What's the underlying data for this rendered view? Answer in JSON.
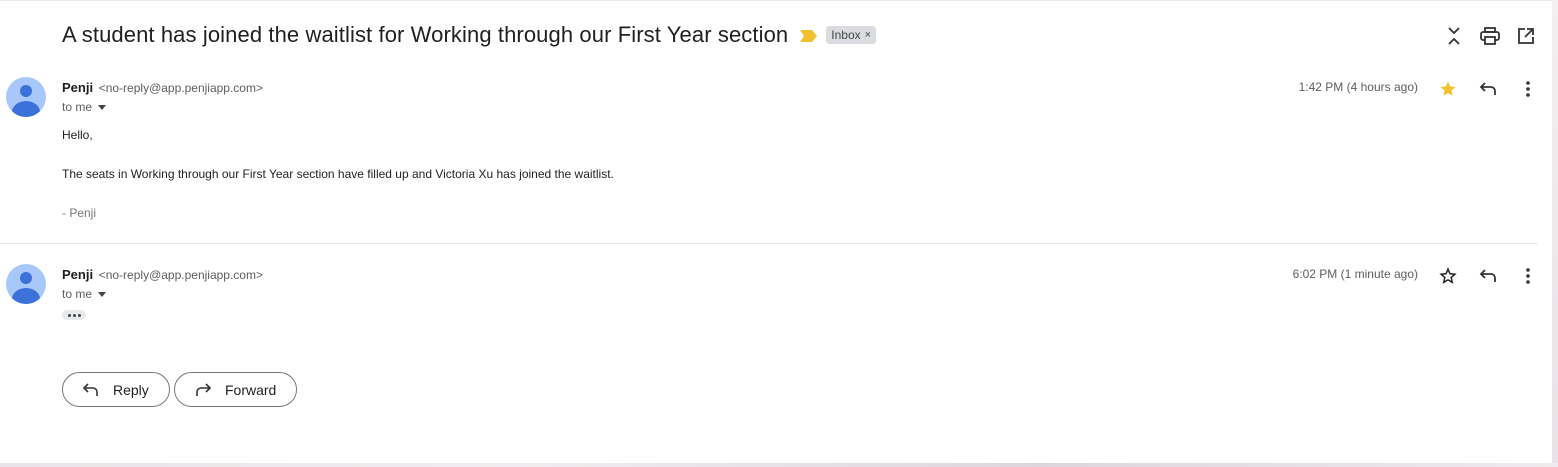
{
  "thread": {
    "subject": "A student has joined the waitlist for Working through our First Year section",
    "label": "Inbox",
    "label_remove": "×"
  },
  "messages": [
    {
      "sender_name": "Penji",
      "sender_email": "<no-reply@app.penjiapp.com>",
      "recipient": "to me",
      "time": "1:42 PM (4 hours ago)",
      "starred": true,
      "greeting": "Hello,",
      "body": "The seats in Working through our First Year section have filled up and Victoria Xu has joined the waitlist.",
      "signature": "- Penji"
    },
    {
      "sender_name": "Penji",
      "sender_email": "<no-reply@app.penjiapp.com>",
      "recipient": "to me",
      "time": "6:02 PM (1 minute ago)",
      "starred": false
    }
  ],
  "footer": {
    "reply_label": "Reply",
    "forward_label": "Forward"
  },
  "colors": {
    "star_filled": "#f4c02f",
    "importance_marker": "#f4c02f",
    "avatar_bg": "#a8c7fa",
    "avatar_fg": "#3b71d8"
  }
}
